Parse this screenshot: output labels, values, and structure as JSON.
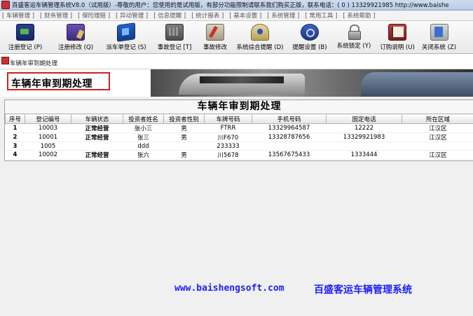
{
  "window": {
    "title": "百盛客运车辆管理系统V8.0（试用版）-尊敬的用户：您使用的是试用版，有部分功能限制请联系我们购买正版，联系电话：( 0 ) 13329921985  http://www.baishe"
  },
  "menu": [
    "[ 车辆管理 ]",
    "[ 财务管理 ]",
    "[ 保险理赔 ]",
    "[ 异动管理 ]",
    "[ 信息提醒 ]",
    "[ 统计报表 ]",
    "[ 基本设置 ]",
    "[ 系统管理 ]",
    "[ 常用工具 ]",
    "[ 系统帮助 ]"
  ],
  "toolbar": [
    {
      "label": "注册登记 (P)",
      "icon": "register-icon"
    },
    {
      "label": "注册修改 (Q)",
      "icon": "edit-register-icon"
    },
    {
      "label": "派车单登记 (S)",
      "icon": "dispatch-icon"
    },
    {
      "label": "事故登记 [T]",
      "icon": "accident-register-icon"
    },
    {
      "label": "事故修改",
      "icon": "accident-edit-icon"
    },
    {
      "label": "系统综合提醒 (D)",
      "icon": "reminder-icon"
    },
    {
      "label": "提醒设置 (B)",
      "icon": "settings-icon"
    },
    {
      "label": "系统锁定 (Y)",
      "icon": "lock-icon"
    },
    {
      "label": "订购说明 (U)",
      "icon": "manual-icon"
    },
    {
      "label": "关闭系统 (Z)",
      "icon": "close-system-icon"
    }
  ],
  "panel": {
    "caption": "车辆年审到期处理",
    "banner_title": "车辆年审到期处理",
    "grid_title": "车辆年审到期处理"
  },
  "table": {
    "headers": [
      "序号",
      "登记编号",
      "车辆状态",
      "投资者姓名",
      "投资者性别",
      "车牌号码",
      "手机号码",
      "固定电话",
      "所在区域"
    ],
    "rows": [
      [
        "1",
        "10003",
        "正常经营",
        "张小三",
        "男",
        "FTRR",
        "13329964587",
        "12222",
        "江汉区"
      ],
      [
        "2",
        "10001",
        "正常经营",
        "张三",
        "男",
        "川F670",
        "13328787656",
        "13329921983",
        "江汉区"
      ],
      [
        "3",
        "1005",
        "",
        "ddd",
        "",
        "233333",
        "",
        "",
        ""
      ],
      [
        "4",
        "10002",
        "正常经营",
        "张六",
        "男",
        "川5678",
        "13567675433",
        "1333444",
        "江汉区"
      ]
    ]
  },
  "footer": {
    "url": "www.baishengsoft.com",
    "name": "百盛客运车辆管理系统"
  }
}
